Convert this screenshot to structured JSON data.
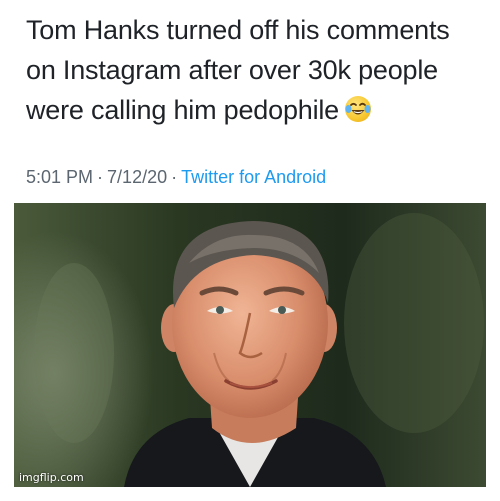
{
  "tweet": {
    "text_lines": [
      "Tom Hanks turned off his comments",
      "on Instagram after over 30k people",
      "were calling him pedophile"
    ],
    "emoji": "face-with-tears-of-joy-icon",
    "time": "5:01 PM",
    "separator": "·",
    "date": "7/12/20",
    "source": "Twitter for Android",
    "source_color": "#1d9bf0"
  },
  "photo": {
    "subject": "portrait-photo"
  },
  "watermark": "imgflip.com"
}
